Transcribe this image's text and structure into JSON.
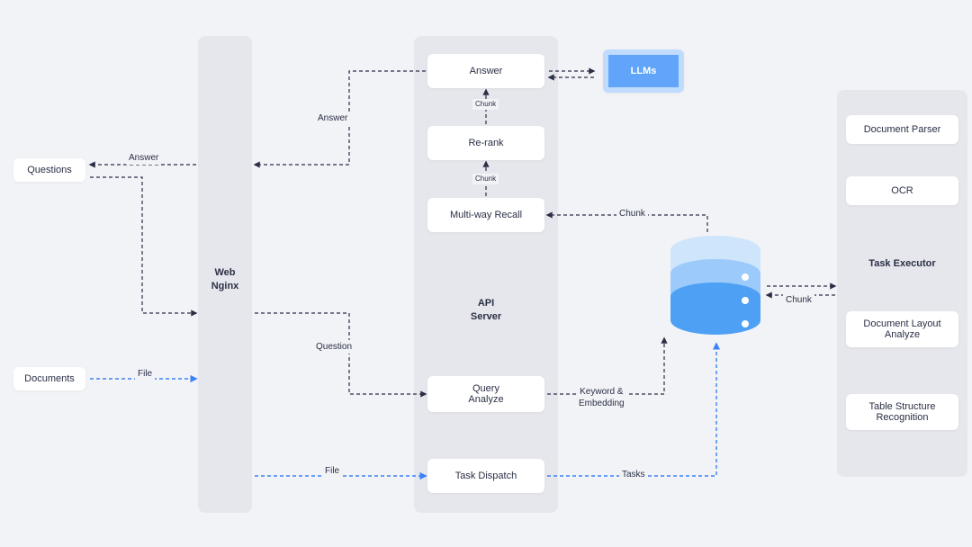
{
  "columns": {
    "web": "Web\nNginx",
    "api": "API\nServer"
  },
  "nodes": {
    "questions": "Questions",
    "documents": "Documents",
    "answer": "Answer",
    "rerank": "Re-rank",
    "multiway": "Multi-way Recall",
    "queryAnalyze": "Query\nAnalyze",
    "taskDispatch": "Task Dispatch",
    "llms": "LLMs",
    "docParser": "Document Parser",
    "ocr": "OCR",
    "taskExecutor": "Task Executor",
    "docLayout": "Document Layout\nAnalyze",
    "tableStruct": "Table Structure\nRecognition"
  },
  "edges": {
    "answerTop": "Answer",
    "answerLeft": "Answer",
    "question": "Question",
    "file1": "File",
    "file2": "File",
    "chunk1": "Chunk",
    "chunk2": "Chunk",
    "chunkRight": "Chunk",
    "chunkExec": "Chunk",
    "keywordEmbed": "Keyword &\nEmbedding",
    "tasks": "Tasks"
  }
}
